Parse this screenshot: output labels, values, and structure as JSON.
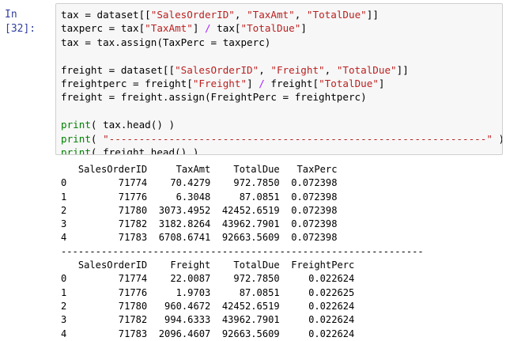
{
  "cell": {
    "prompt": "In [32]:",
    "code_lines": [
      [
        {
          "t": "tax = dataset[[",
          "c": ""
        },
        {
          "t": "\"SalesOrderID\"",
          "c": "str"
        },
        {
          "t": ", ",
          "c": ""
        },
        {
          "t": "\"TaxAmt\"",
          "c": "str"
        },
        {
          "t": ", ",
          "c": ""
        },
        {
          "t": "\"TotalDue\"",
          "c": "str"
        },
        {
          "t": "]]",
          "c": ""
        }
      ],
      [
        {
          "t": "taxperc = tax[",
          "c": ""
        },
        {
          "t": "\"TaxAmt\"",
          "c": "str"
        },
        {
          "t": "] ",
          "c": ""
        },
        {
          "t": "/",
          "c": "op"
        },
        {
          "t": " tax[",
          "c": ""
        },
        {
          "t": "\"TotalDue\"",
          "c": "str"
        },
        {
          "t": "]",
          "c": ""
        }
      ],
      [
        {
          "t": "tax = tax.assign(TaxPerc = taxperc)",
          "c": ""
        }
      ],
      [
        {
          "t": "",
          "c": ""
        }
      ],
      [
        {
          "t": "freight = dataset[[",
          "c": ""
        },
        {
          "t": "\"SalesOrderID\"",
          "c": "str"
        },
        {
          "t": ", ",
          "c": ""
        },
        {
          "t": "\"Freight\"",
          "c": "str"
        },
        {
          "t": ", ",
          "c": ""
        },
        {
          "t": "\"TotalDue\"",
          "c": "str"
        },
        {
          "t": "]]",
          "c": ""
        }
      ],
      [
        {
          "t": "freightperc = freight[",
          "c": ""
        },
        {
          "t": "\"Freight\"",
          "c": "str"
        },
        {
          "t": "] ",
          "c": ""
        },
        {
          "t": "/",
          "c": "op"
        },
        {
          "t": " freight[",
          "c": ""
        },
        {
          "t": "\"TotalDue\"",
          "c": "str"
        },
        {
          "t": "]",
          "c": ""
        }
      ],
      [
        {
          "t": "freight = freight.assign(FreightPerc = freightperc)",
          "c": ""
        }
      ],
      [
        {
          "t": "",
          "c": ""
        }
      ],
      [
        {
          "t": "print",
          "c": "fn"
        },
        {
          "t": "( tax.head() )",
          "c": ""
        }
      ],
      [
        {
          "t": "print",
          "c": "fn"
        },
        {
          "t": "( ",
          "c": ""
        },
        {
          "t": "\"---------------------------------------------------------------\"",
          "c": "str"
        },
        {
          "t": " )",
          "c": ""
        }
      ],
      [
        {
          "t": "print",
          "c": "fn"
        },
        {
          "t": "( freight.head() )",
          "c": ""
        }
      ]
    ]
  },
  "output": {
    "lines": [
      "   SalesOrderID     TaxAmt    TotalDue   TaxPerc",
      "0         71774    70.4279    972.7850  0.072398",
      "1         71776     6.3048     87.0851  0.072398",
      "2         71780  3073.4952  42452.6519  0.072398",
      "3         71782  3182.8264  43962.7901  0.072398",
      "4         71783  6708.6741  92663.5609  0.072398",
      "---------------------------------------------------------------",
      "   SalesOrderID    Freight    TotalDue  FreightPerc",
      "0         71774    22.0087    972.7850     0.022624",
      "1         71776     1.9703     87.0851     0.022625",
      "2         71780   960.4672  42452.6519     0.022624",
      "3         71782   994.6333  43962.7901     0.022624",
      "4         71783  2096.4607  92663.5609     0.022624"
    ]
  }
}
